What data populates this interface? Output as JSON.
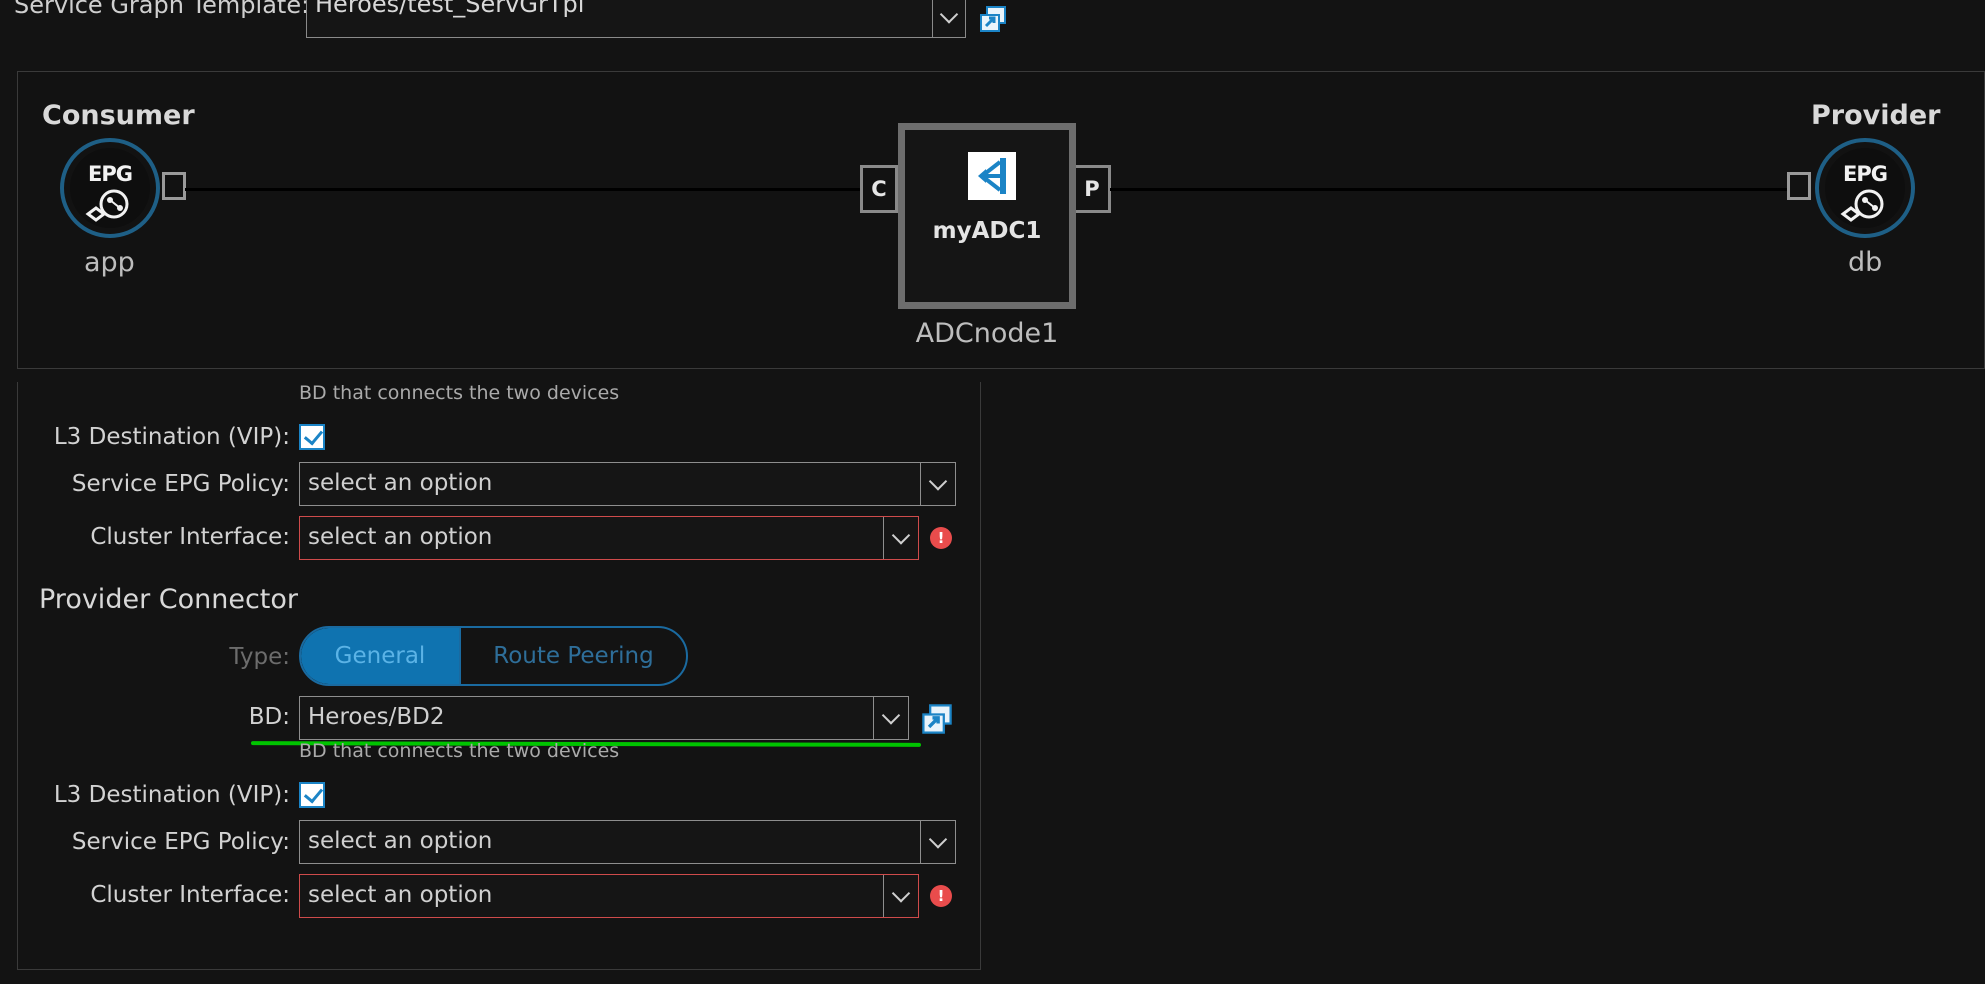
{
  "template": {
    "label": "Service Graph Template:",
    "value": "Heroes/test_ServGrTpl"
  },
  "graph": {
    "consumer": {
      "title": "Consumer",
      "badge": "EPG",
      "name": "app"
    },
    "provider": {
      "title": "Provider",
      "badge": "EPG",
      "name": "db"
    },
    "node": {
      "label": "myADC1",
      "caption": "ADCnode1",
      "consumer_port": "C",
      "provider_port": "P"
    }
  },
  "consumer_section": {
    "bd_hint": "BD that connects the two devices",
    "l3_label": "L3 Destination (VIP):",
    "l3_checked": true,
    "epg_policy_label": "Service EPG Policy:",
    "epg_policy_value": "select an option",
    "cluster_label": "Cluster Interface:",
    "cluster_value": "select an option",
    "cluster_error_icon": "!"
  },
  "provider_section": {
    "title": "Provider Connector",
    "type_label": "Type:",
    "type_options": [
      "General",
      "Route Peering"
    ],
    "type_selected": "General",
    "bd_label": "BD:",
    "bd_value": "Heroes/BD2",
    "bd_hint": "BD that connects the two devices",
    "l3_label": "L3 Destination (VIP):",
    "l3_checked": true,
    "epg_policy_label": "Service EPG Policy:",
    "epg_policy_value": "select an option",
    "cluster_label": "Cluster Interface:",
    "cluster_value": "select an option",
    "cluster_error_icon": "!"
  },
  "colors": {
    "accent": "#0f73b0",
    "error": "#e94c4c",
    "highlight": "#00c400"
  }
}
